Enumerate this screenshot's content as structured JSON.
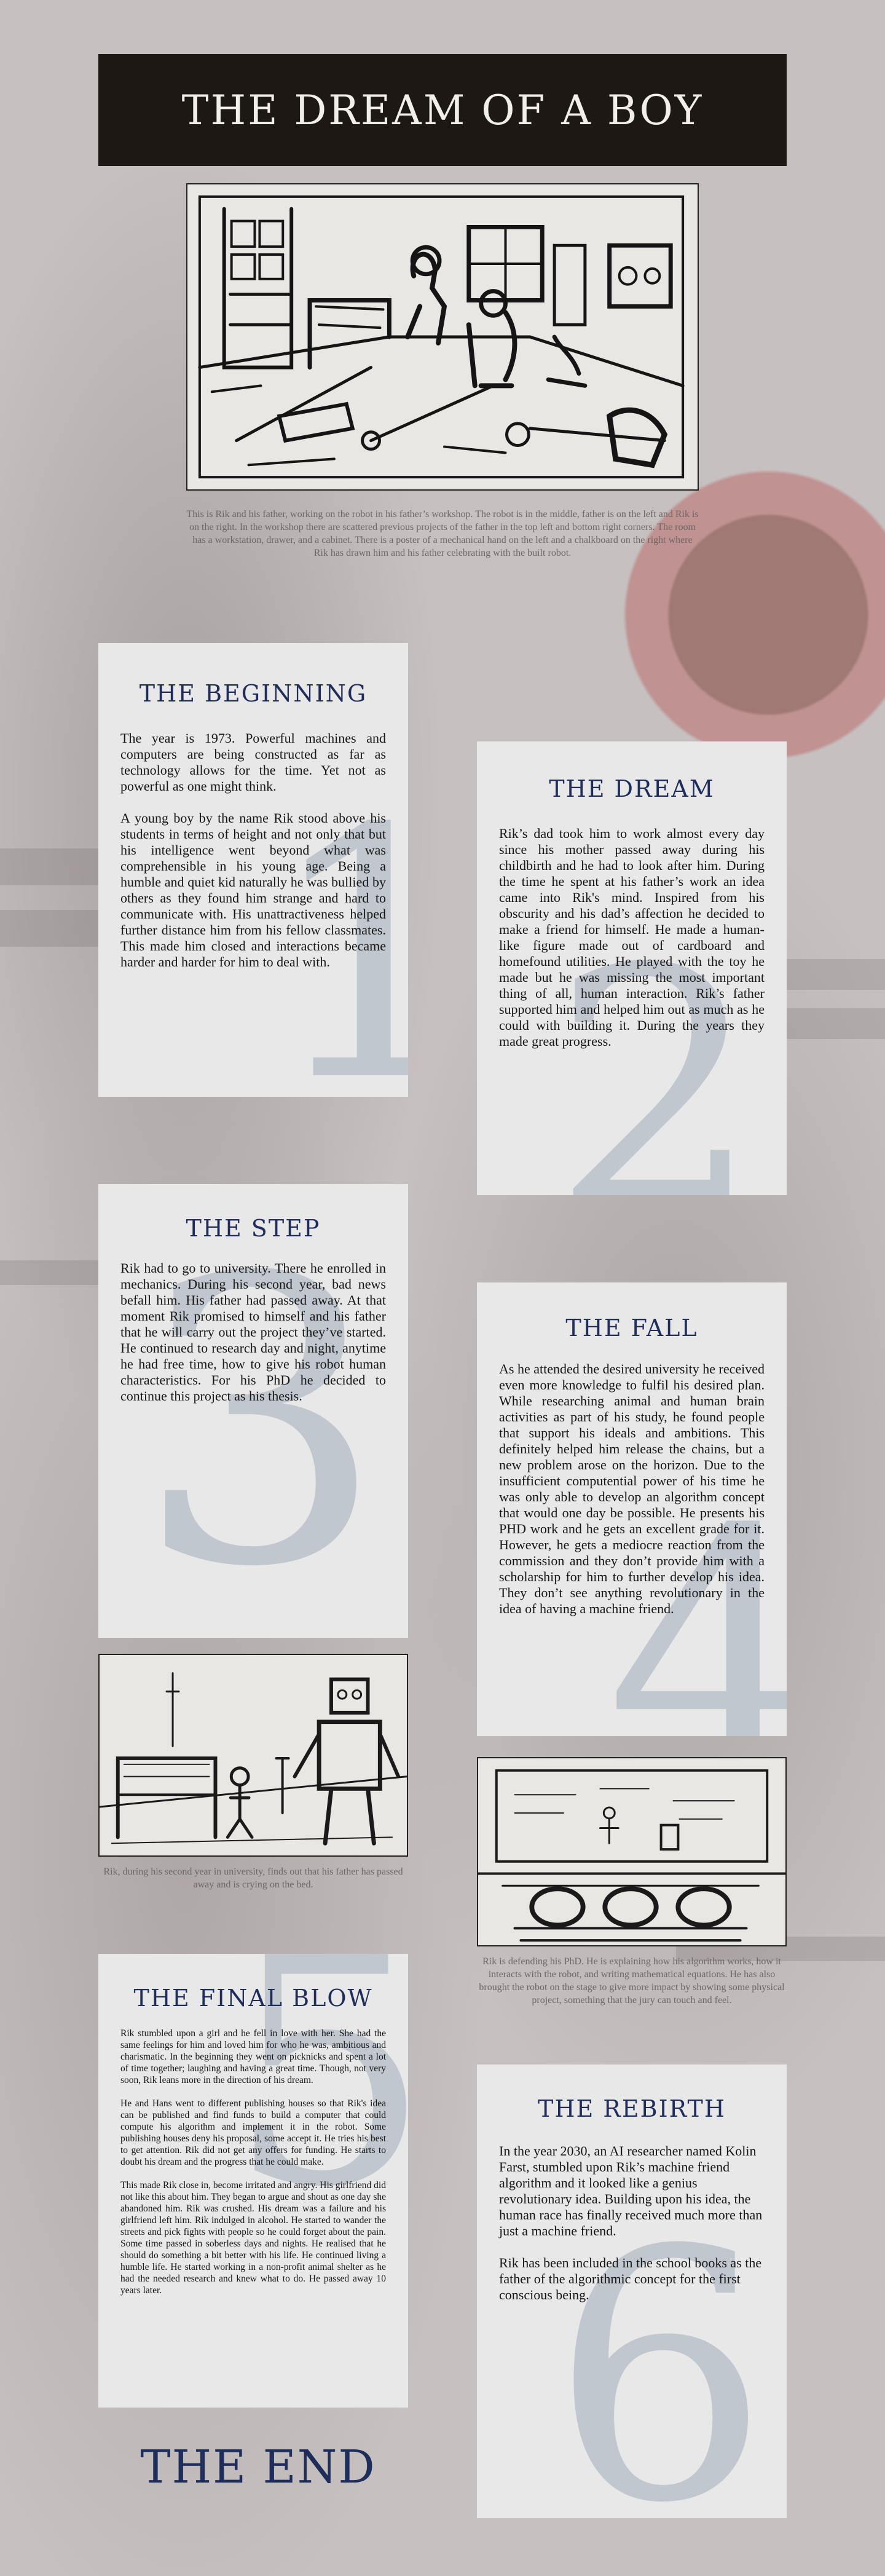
{
  "title": "The Dream of a Boy",
  "hero": {
    "caption": "This is Rik and his father, working on the robot in his father’s workshop. The robot is in the middle, father is on the left and Rik is on the right. In the workshop there are scattered previous projects of the father in the top left and bottom right corners. The room has a workstation, drawer, and a cabinet. There is a poster of a mechanical hand on the left and a chalkboard on the right where Rik has drawn him and his father celebrating with the built robot."
  },
  "sections": {
    "beginning": {
      "number": "1",
      "heading": "The Beginning",
      "paragraphs": [
        "The year is 1973. Powerful machines and computers are being constructed as far as technology allows for the time. Yet not as powerful as one might think.",
        "A young boy by the name Rik stood above his students in terms of height and not only that but his intelligence went beyond what was comprehensible in his young age. Being a humble and quiet kid naturally he was bullied by others as they found him strange and hard to communicate with. His unattractiveness helped further distance him from his fellow classmates. This made him closed and interactions became harder and harder for him to deal with."
      ]
    },
    "dream": {
      "number": "2",
      "heading": "The Dream",
      "paragraphs": [
        "Rik’s dad took him to work almost every day since his mother passed away during his childbirth and he had to look after him. During the time he spent at his father’s work an idea came into Rik's mind. Inspired from his obscurity and his dad’s affection he decided to make a friend for himself. He made a human-like figure made out of cardboard and homefound utilities. He played with the toy he made but he was missing the most important thing of all, human interaction. Rik’s father supported him and helped him out as much as he could with building it. During the years they made great progress."
      ]
    },
    "step": {
      "number": "3",
      "heading": "The Step",
      "paragraphs": [
        "Rik had to go to university. There he enrolled in mechanics. During his second year, bad news befall him. His father had passed away. At that moment Rik promised to himself and his father that he will carry out the project they’ve started. He continued to research day and night, anytime he had free time, how to give his robot human characteristics. For his PhD he decided to continue this project as his thesis."
      ]
    },
    "fall": {
      "number": "4",
      "heading": "The Fall",
      "paragraphs": [
        "As he attended the desired university he received even more knowledge to fulfil his desired plan. While researching animal and human brain activities as part of his study, he found people that support his ideals and ambitions. This definitely helped him release the chains, but a new problem arose on the horizon. Due to the insufficient computential power of his time he was only able to develop an algorithm concept that would one day be possible. He presents his PHD work and he gets an excellent grade for it. However, he gets a mediocre reaction from the commission and they don’t provide him with a scholarship for him to further develop his idea. They don’t see anything revolutionary in the idea of having a machine friend."
      ]
    },
    "final_blow": {
      "number": "5",
      "heading": "The Final Blow",
      "paragraphs": [
        "Rik stumbled upon a girl and he fell in love with her. She had the same feelings for him and loved him for who he was, ambitious and charismatic. In the beginning they went on picknicks and spent a lot of time together; laughing and having a great time. Though, not very soon, Rik leans more in the direction of his dream.",
        "He and Hans went to different publishing houses so that Rik's idea can be published and find funds to build a computer that could compute his algorithm and implement it in the robot. Some publishing houses deny his proposal, some accept it. He tries his best to get attention. Rik did not get any offers for funding. He starts to doubt his dream and the progress that he could make.",
        "This made Rik close in, become irritated and angry. His girlfriend did not like this about him. They began to argue and shout as one day she abandoned him. Rik was crushed. His dream was a failure and his girlfriend left him. Rik indulged in alcohol. He started to wander the streets and pick fights with people so he could forget about the pain. Some time passed in soberless days and nights. He realised that he should do something a bit better with his life. He continued living a humble life. He started working in a non-profit animal shelter as he had the needed research and knew what to do. He passed away 10 years later."
      ]
    },
    "rebirth": {
      "number": "6",
      "heading": "The Rebirth",
      "paragraphs": [
        "In the year 2030, an AI researcher named Kolin Farst, stumbled upon Rik’s machine friend algorithm and it looked like a genius revolutionary idea. Building upon his idea, the human race has finally received much more than just a machine friend.",
        "Rik has been included in the school books as the father of the algorithmic concept for the first conscious being."
      ]
    }
  },
  "sketch_bed": {
    "caption": "Rik, during his second year in university, finds out that his father has passed away and is crying on the bed."
  },
  "sketch_phd": {
    "caption": "Rik is defending his PhD. He is explaining how his algorithm works, how it interacts with the robot, and writing mathematical equations. He has also brought the robot on the stage to give more impact by showing some physical project, something that the jury can touch and feel."
  },
  "end": "The End",
  "colors": {
    "title_bar": "#1d1814",
    "heading": "#1f2d5a",
    "card": "#e9e8e8",
    "numeral": "#c1c7cf",
    "background": "#c6c0c0"
  }
}
